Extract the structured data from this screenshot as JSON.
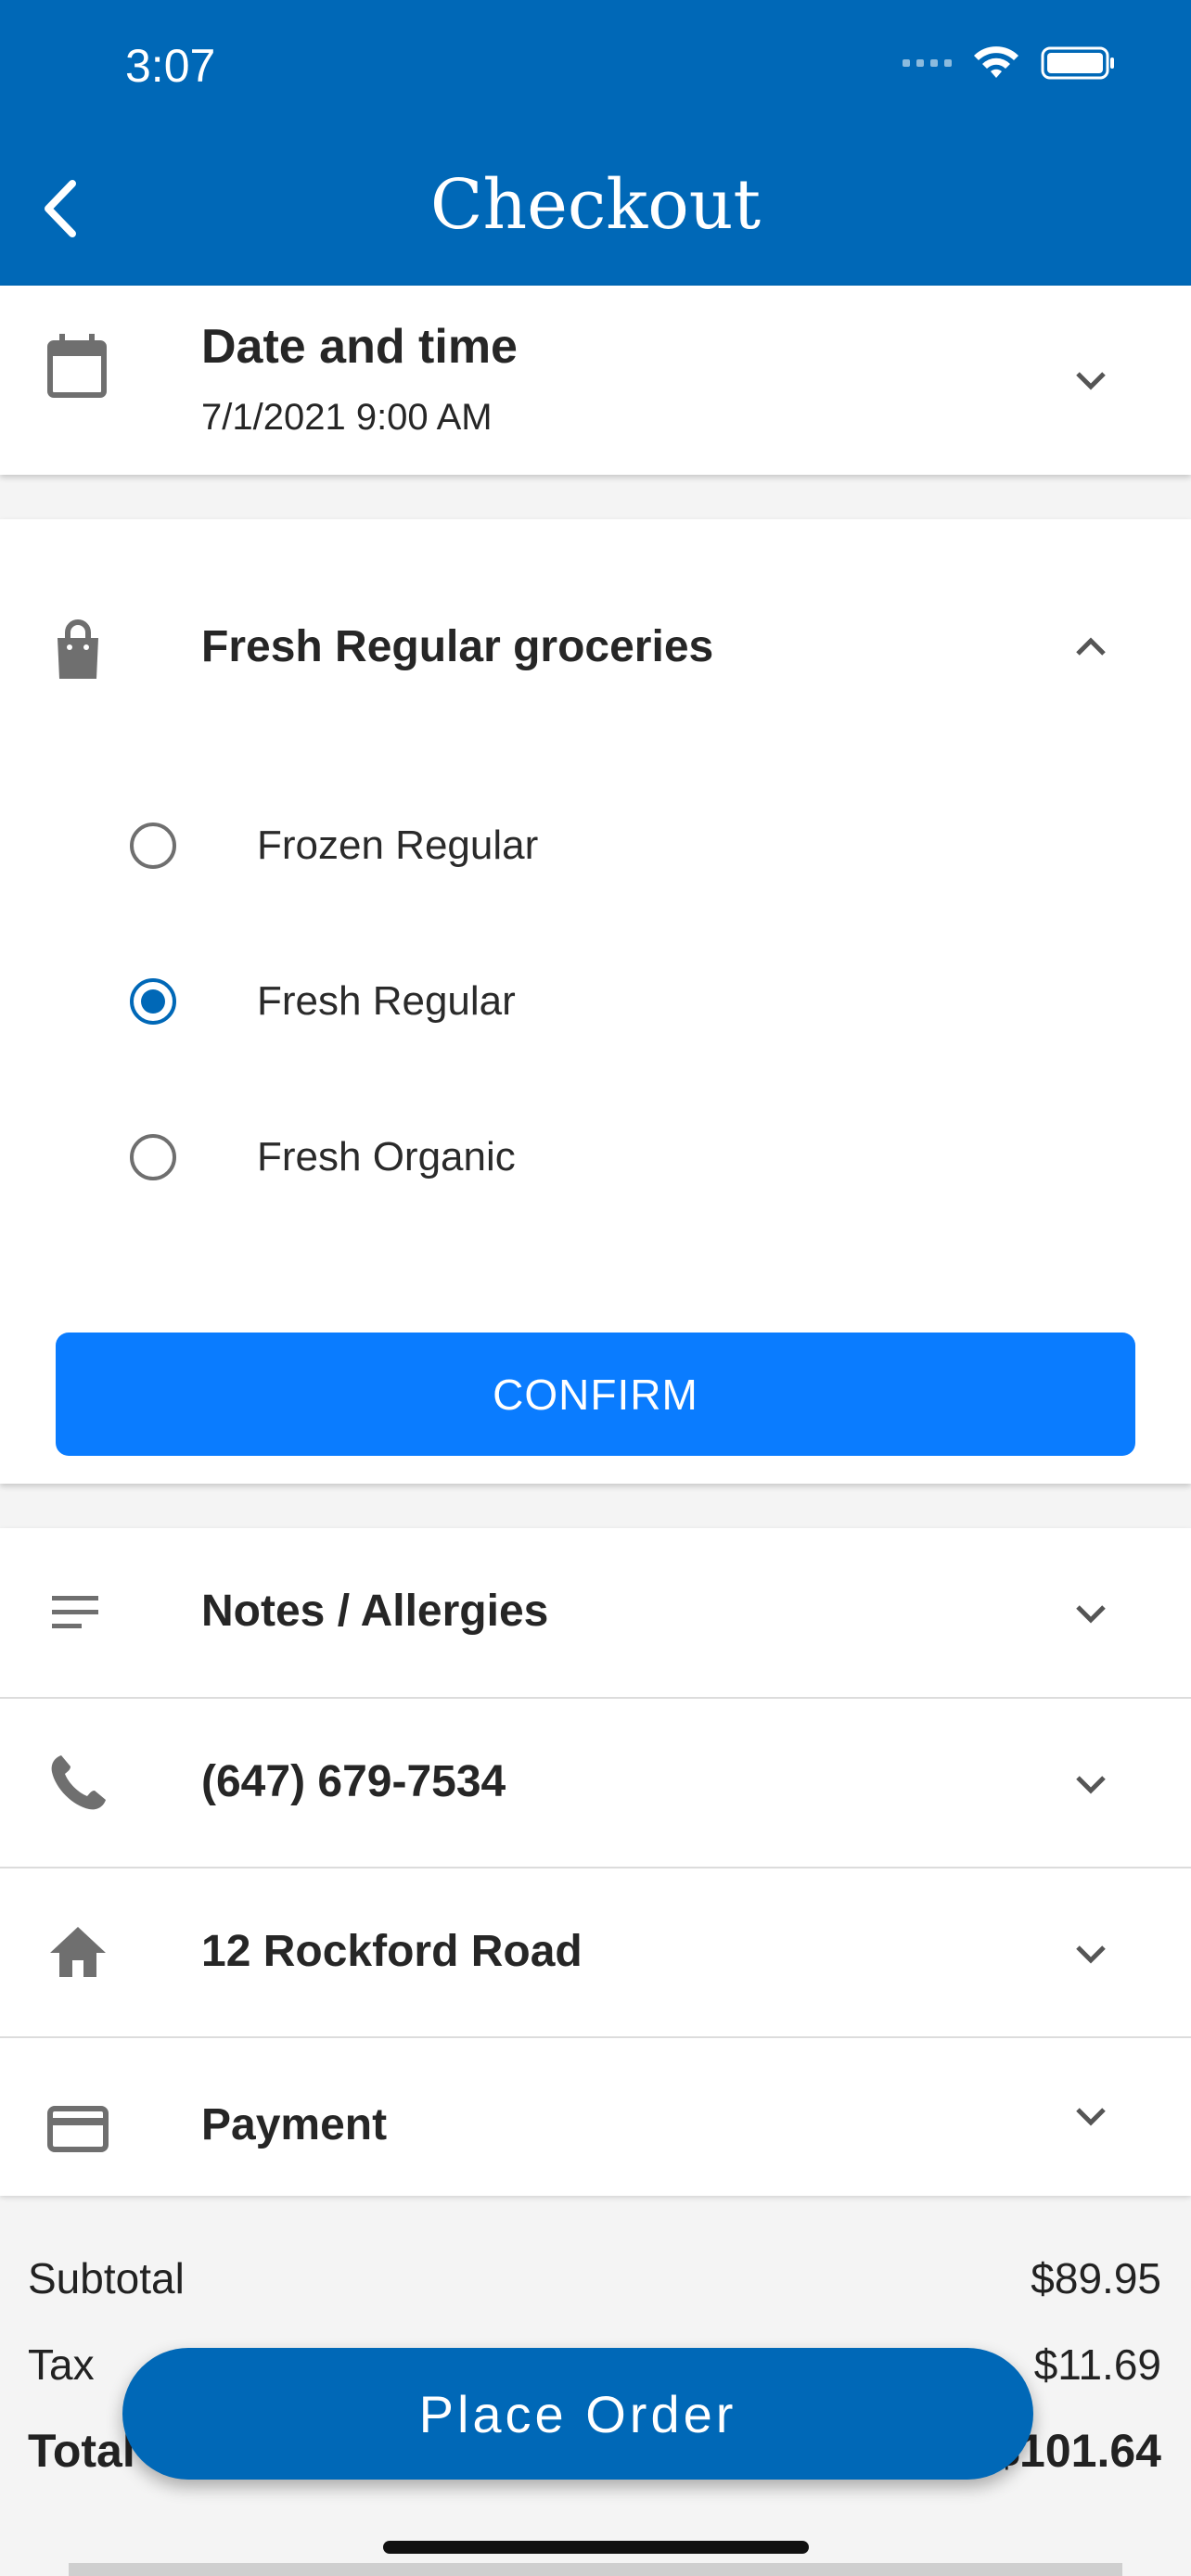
{
  "status_bar": {
    "time": "3:07"
  },
  "header": {
    "title": "Checkout"
  },
  "date_section": {
    "label": "Date and time",
    "value": "7/1/2021 9:00 AM"
  },
  "grocery_section": {
    "label": "Fresh Regular groceries",
    "options": [
      {
        "label": "Frozen Regular",
        "selected": false
      },
      {
        "label": "Fresh Regular",
        "selected": true
      },
      {
        "label": "Fresh Organic",
        "selected": false
      }
    ],
    "confirm_label": "CONFIRM"
  },
  "rows": {
    "notes": "Notes / Allergies",
    "phone": "(647) 679-7534",
    "address": "12 Rockford Road",
    "payment": "Payment"
  },
  "summary": {
    "subtotal_label": "Subtotal",
    "subtotal_value": "$89.95",
    "tax_label": "Tax",
    "tax_value": "$11.69",
    "total_label": "Total",
    "total_value": "$101.64"
  },
  "place_order_label": "Place Order",
  "colors": {
    "primary": "#0068b7",
    "confirm": "#0a7cff",
    "icon_gray": "#6f6f6f"
  }
}
